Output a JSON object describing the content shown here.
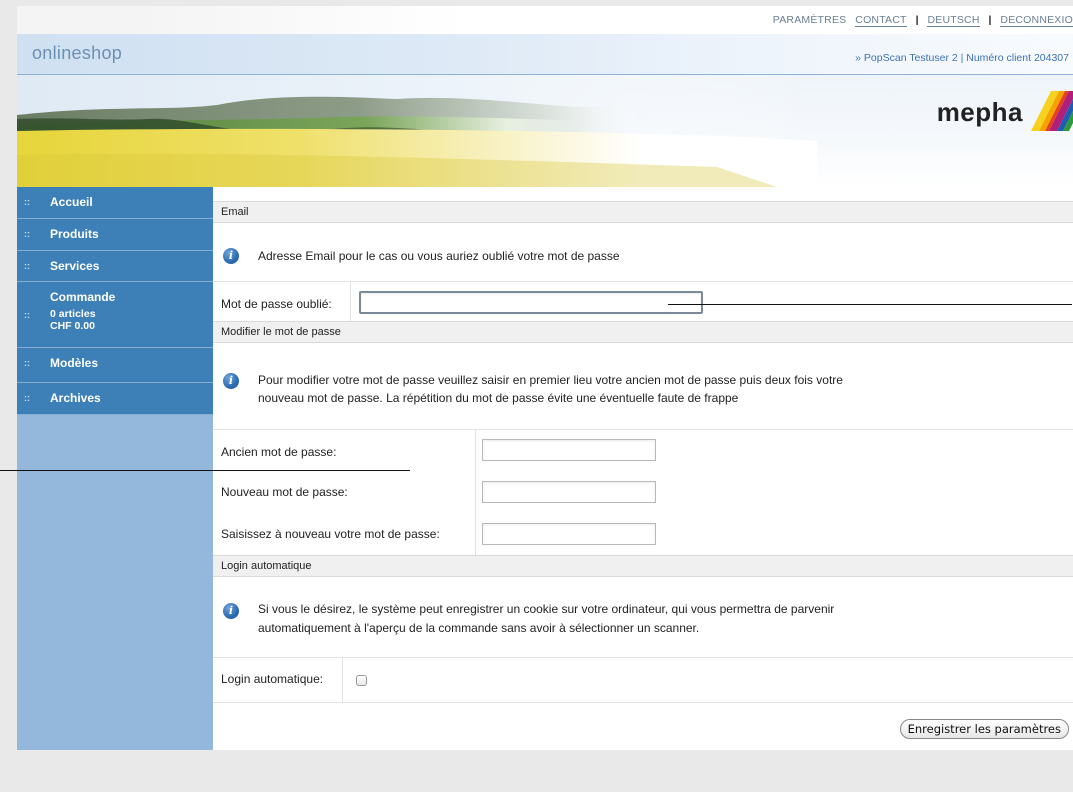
{
  "top_links": {
    "settings": "PARAMÈTRES",
    "contact": "CONTACT",
    "language": "DEUTSCH",
    "logout": "DECONNEXIO",
    "separator": "|"
  },
  "header": {
    "shop_name": "onlineshop",
    "user_info": "» PopScan Testuser 2 | Numéro client 204307"
  },
  "brand": {
    "logo_text": "mepha"
  },
  "sidebar": {
    "items": [
      {
        "label": "Accueil",
        "bullet": "::"
      },
      {
        "label": "Produits",
        "bullet": "::"
      },
      {
        "label": "Services",
        "bullet": "::"
      },
      {
        "label": "Commande",
        "bullet": "::",
        "sub1": "0 articles",
        "sub2": "CHF 0.00"
      },
      {
        "label": "Modèles",
        "bullet": "::"
      },
      {
        "label": "Archives",
        "bullet": "::"
      }
    ]
  },
  "email_section": {
    "title": "Email",
    "info": "Adresse Email pour le cas ou vous auriez oublié votre mot de passe",
    "field_label": "Mot de passe oublié:",
    "field_value": ""
  },
  "password_section": {
    "title": "Modifier le mot de passe",
    "info_line1": "Pour modifier votre mot de passe veuillez saisir en premier lieu votre ancien mot de passe puis deux fois votre",
    "info_line2": "nouveau mot de passe. La répétition du mot de passe évite une éventuelle faute de frappe",
    "old_label": "Ancien mot de passe:",
    "new_label": "Nouveau mot de passe:",
    "repeat_label": "Saisissez à nouveau votre mot de passe:"
  },
  "autologin_section": {
    "title": "Login automatique",
    "info_line1": "Si vous le désirez, le système peut enregistrer un cookie sur votre ordinateur, qui vous permettra de parvenir",
    "info_line2": "automatiquement à l'aperçu de la commande sans avoir à sélectionner un scanner.",
    "field_label": "Login automatique:",
    "checked": false
  },
  "save_button": "Enregistrer les paramètres",
  "icons": {
    "info": "info-icon",
    "nav_bullet": "nav-bullet-icon",
    "logo_mark": "mepha-logo-mark"
  },
  "colors": {
    "nav_blue": "#3d80b8",
    "sidebar_blue": "#93b8dc",
    "link_blue": "#3d72b4"
  }
}
